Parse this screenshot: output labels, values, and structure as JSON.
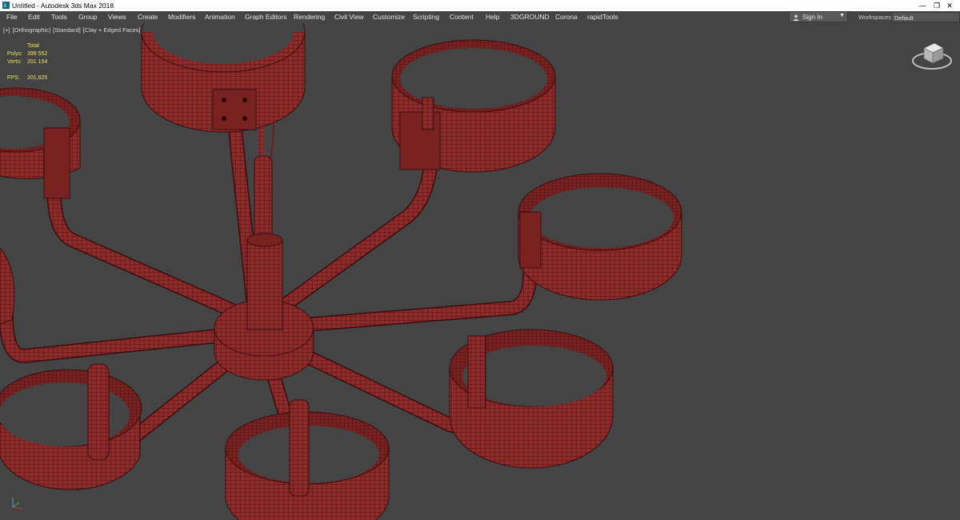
{
  "window": {
    "title": "Untitled - Autodesk 3ds Max 2018",
    "controls": [
      "—",
      "❐",
      "✕"
    ]
  },
  "menu": [
    "File",
    "Edit",
    "Tools",
    "Group",
    "Views",
    "Create",
    "Modifiers",
    "Animation",
    "Graph Editors",
    "Rendering",
    "Civil View",
    "Customize",
    "Scripting",
    "Content",
    "Help",
    "3DGROUND",
    "Corona",
    "rapidTools"
  ],
  "account": {
    "sign_in": "Sign In",
    "icon": "person-icon"
  },
  "workspaces": {
    "label": "Workspaces:",
    "value": "Default"
  },
  "viewport": {
    "labels": [
      "[+]",
      "[Orthographic]",
      "[Standard]",
      "[Clay + Edged Faces]"
    ],
    "stats_header": "Total",
    "stats": [
      {
        "key": "Polys:",
        "value": "399 552"
      },
      {
        "key": "Verts:",
        "value": "201 154"
      }
    ],
    "fps_key": "FPS:",
    "fps_value": "201,625"
  },
  "colors": {
    "viewport_bg": "#444444",
    "mesh_fill": "#8e2a2a",
    "mesh_wire": "#3a0d0d",
    "stats_text": "#f2e35c"
  }
}
